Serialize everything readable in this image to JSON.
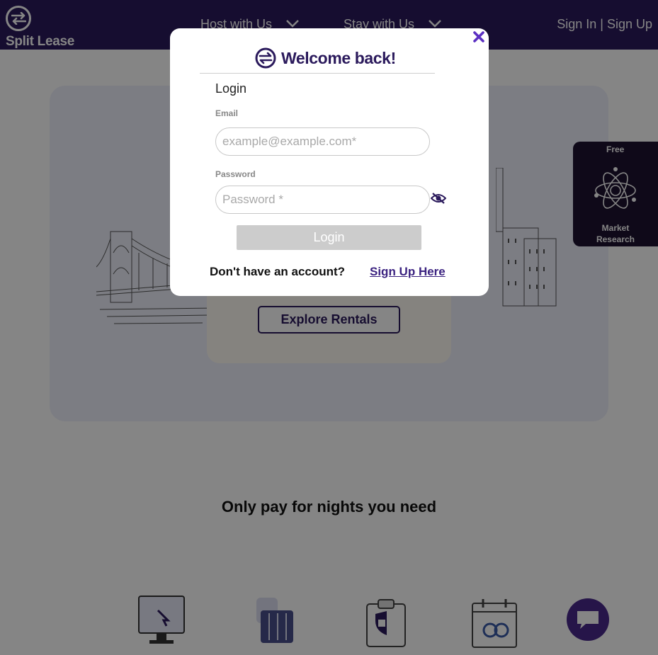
{
  "navbar": {
    "logo_text": "Split Lease",
    "items": [
      {
        "label": "Host with Us"
      },
      {
        "label": "Stay with Us"
      }
    ],
    "auth_label": "Sign In | Sign Up"
  },
  "hero": {
    "cta_label": "Explore Rentals"
  },
  "side_tab": {
    "top_label": "Free",
    "bottom_label_line1": "Market",
    "bottom_label_line2": "Research",
    "icon": "atom-icon"
  },
  "section": {
    "tagline": "Only pay for nights you need"
  },
  "modal": {
    "title": "Welcome back!",
    "heading": "Login",
    "email_label": "Email",
    "email_placeholder": "example@example.com*",
    "email_value": "",
    "password_label": "Password",
    "password_placeholder": "Password *",
    "password_value": "",
    "login_button": "Login",
    "no_account_text": "Don't have an account?",
    "signup_link": "Sign Up Here"
  },
  "colors": {
    "brand": "#2b1a5c",
    "accent": "#5b2fc2",
    "login_button_disabled": "#cccccc"
  }
}
